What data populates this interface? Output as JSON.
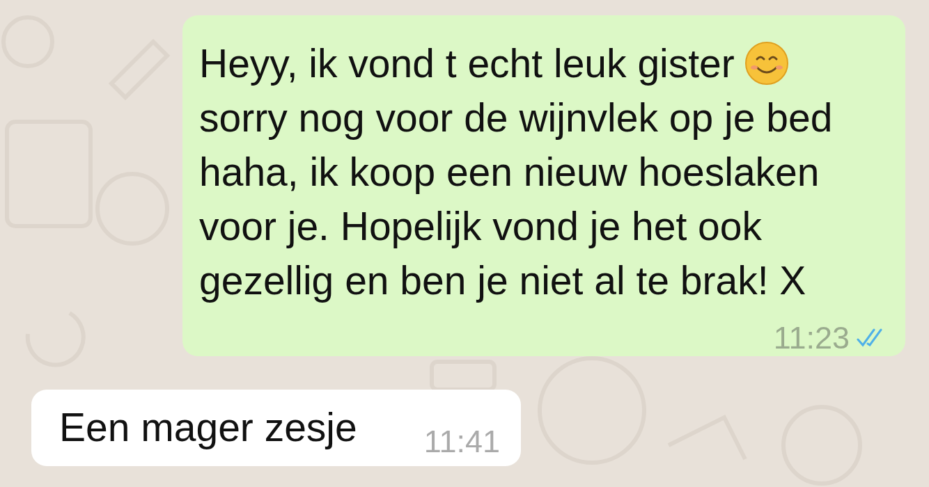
{
  "messages": [
    {
      "kind": "outgoing",
      "first_line": "Heyy, ik vond t echt leuk gister",
      "emoji": true,
      "lines": [
        "sorry nog voor de wijnvlek op je bed",
        "haha, ik koop een nieuw hoeslaken",
        "voor je. Hopelijk vond je het ook",
        "gezellig en ben je niet al te brak! X"
      ],
      "time": "11:23",
      "read": true
    },
    {
      "kind": "incoming",
      "first_line": "Een mager zesje",
      "time": "11:41"
    }
  ]
}
